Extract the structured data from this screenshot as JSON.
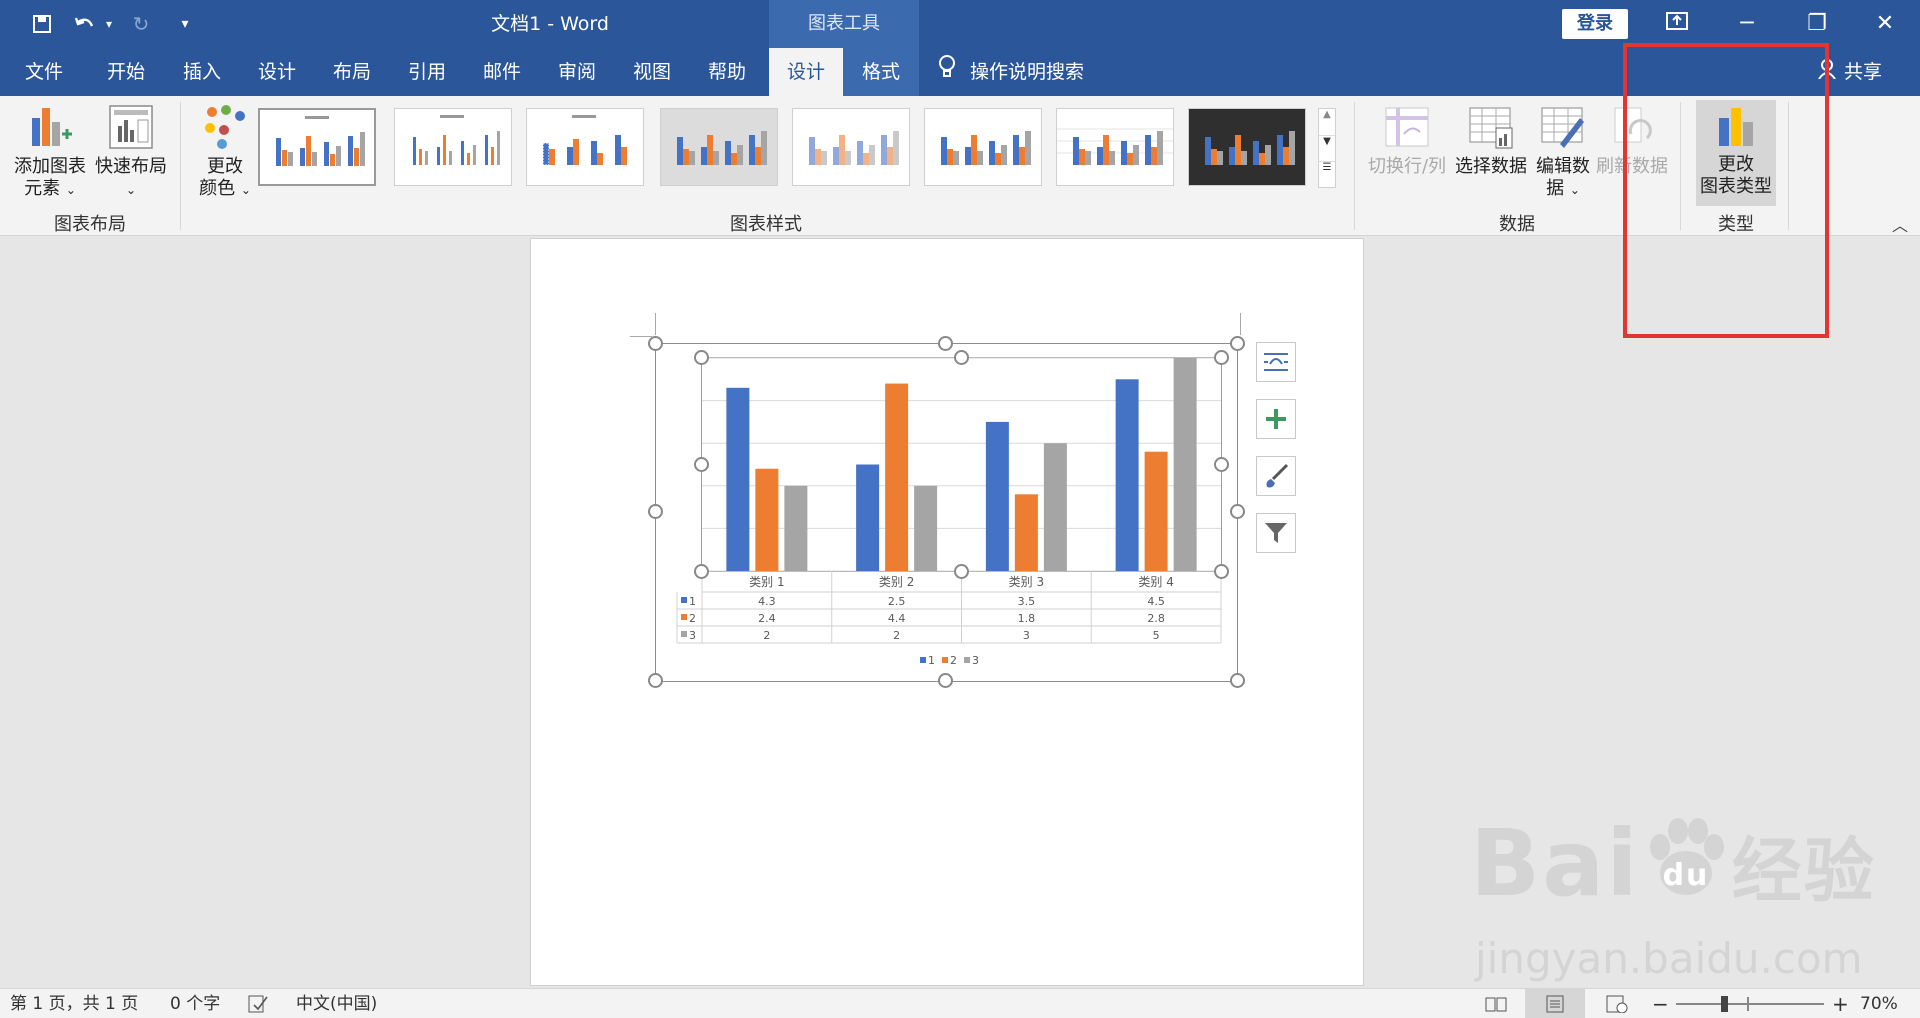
{
  "titlebar": {
    "doc_title": "文档1  -  Word",
    "tools_label": "图表工具",
    "login_label": "登录"
  },
  "tabs": [
    {
      "label": "文件"
    },
    {
      "label": "开始"
    },
    {
      "label": "插入"
    },
    {
      "label": "设计"
    },
    {
      "label": "布局"
    },
    {
      "label": "引用"
    },
    {
      "label": "邮件"
    },
    {
      "label": "审阅"
    },
    {
      "label": "视图"
    },
    {
      "label": "帮助"
    },
    {
      "label": "设计"
    },
    {
      "label": "格式"
    }
  ],
  "tell_me": "操作说明搜索",
  "share": "共享",
  "ribbon": {
    "add_element_line1": "添加图表",
    "add_element_line2": "元素",
    "quick_layout": "快速布局",
    "change_colors_line1": "更改",
    "change_colors_line2": "颜色",
    "switch_row_col": "切换行/列",
    "select_data": "选择数据",
    "edit_data_line1": "编辑数",
    "edit_data_line2": "据",
    "refresh_data": "刷新数据",
    "change_type_line1": "更改",
    "change_type_line2": "图表类型",
    "group_layout": "图表布局",
    "group_styles": "图表样式",
    "group_data": "数据",
    "group_type": "类型"
  },
  "colors": {
    "brand": "#2b579a",
    "series1": "#4472c4",
    "series2": "#ed7d31",
    "series3": "#a5a5a5",
    "highlight": "#e63333"
  },
  "chart_data": {
    "type": "bar",
    "categories": [
      "类别 1",
      "类别 2",
      "类别 3",
      "类别 4"
    ],
    "series": [
      {
        "name": "1",
        "values": [
          4.3,
          2.5,
          3.5,
          4.5
        ]
      },
      {
        "name": "2",
        "values": [
          2.4,
          4.4,
          1.8,
          2.8
        ]
      },
      {
        "name": "3",
        "values": [
          2,
          2,
          3,
          5
        ]
      }
    ],
    "ylim": [
      0,
      5
    ],
    "grid": true,
    "legend": "bottom",
    "data_table": true
  },
  "statusbar": {
    "page_info": "第 1 页，共 1 页",
    "word_count": "0 个字",
    "language": "中文(中国)",
    "zoom": "70%"
  },
  "watermark": {
    "text1": "Bai",
    "text2": "经验",
    "text3": "jingyan.baidu.com"
  }
}
